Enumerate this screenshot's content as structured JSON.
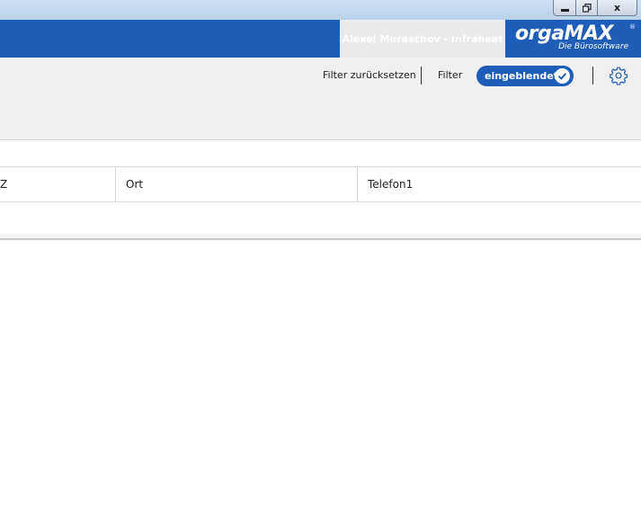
{
  "window": {
    "minimize_icon": "minimize-icon",
    "restore_icon": "restore-icon",
    "close_glyph": "x"
  },
  "header": {
    "user": "Alexej Muraschov - Infraheat",
    "logo_text": "orgaMAX",
    "logo_registered": "®",
    "logo_tagline": "Die Bürosoftware",
    "brand_color": "#1e5db8"
  },
  "toolbar": {
    "reset_filter": "Filter zurücksetzen",
    "filter_label": "Filter",
    "filter_state": "eingeblendet",
    "settings_icon": "gear-icon"
  },
  "grid": {
    "columns": [
      "Z",
      "Ort",
      "Telefon1"
    ]
  }
}
